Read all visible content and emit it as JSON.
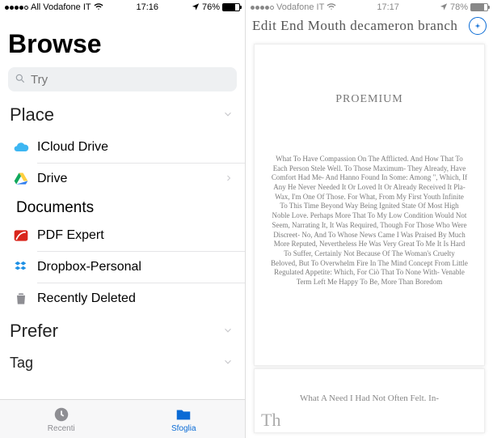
{
  "left": {
    "status": {
      "carrier": "All Vodafone IT",
      "time": "17:16",
      "battery_pct": "76%"
    },
    "title": "Browse",
    "search_placeholder": "Try",
    "sections": {
      "place": "Place",
      "documents": "Documents",
      "prefer": "Prefer",
      "tag": "Tag"
    },
    "rows": {
      "icloud": "ICloud Drive",
      "drive": "Drive",
      "pdfexpert": "PDF Expert",
      "dropbox": "Dropbox-Personal",
      "deleted": "Recently Deleted"
    },
    "tabs": {
      "recent": "Recenti",
      "browse": "Sfoglia"
    }
  },
  "right": {
    "status": {
      "carrier": "Vodafone IT",
      "time": "17:17",
      "battery_pct": "78%"
    },
    "doc_title": "Edit End Mouth  decameron  branch",
    "page": {
      "heading": "PROEMIUM",
      "body": "What To Have Compassion On The Afflicted. And How That To Each Person Stele Well. To Those Maximum- They Already, Have Comfort Had Me- And Hanno Found In Some: Among \", Which, If Any He Never Needed It Or Loved It Or Already Received It Pla- Wax, I'm One Of Those. For What, From My First Youth Infinite To This Time Beyond Way Being Ignited State Of Most High Noble Love. Perhaps More That To My Low Condition Would Not Seem, Narrating It, It Was Required, Though For Those Who Were Discreet- No, And To Whose News Came I Was Praised By Much More Reputed, Nevertheless He Was Very Great To Me It Is Hard To Suffer, Certainly Not Because Of The Woman's Cruelty Beloved, But To Overwhelm Fire In The Mind Concept From Little Regulated Appetite: Which, For Ciò That To None With- Venable Term Left Me Happy To Be, More Than Boredom"
    },
    "page2": {
      "line": "What A Need I Had Not Often Felt. In-",
      "dropcap": "Th"
    }
  }
}
